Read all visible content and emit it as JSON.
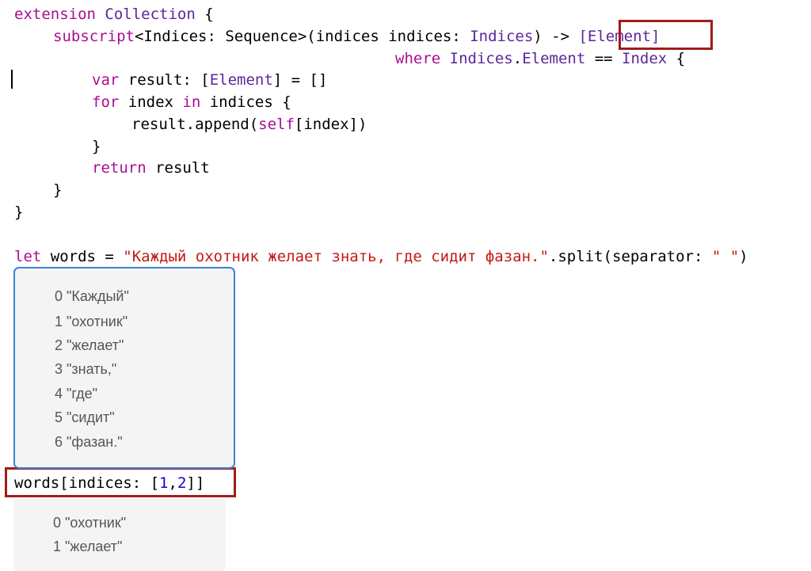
{
  "code": {
    "ext_kw": "extension",
    "ext_type": "Collection",
    "ext_open": " {",
    "sub_kw": "subscript",
    "sub_lt": "<Indices: Sequence>(indices indices: ",
    "sub_param_type": "Indices",
    "sub_arrow": ") -> ",
    "sub_ret": "[Element]",
    "where_kw": "where",
    "where_type1": "Indices",
    "where_dot": ".",
    "where_type2": "Element",
    "where_eq": " == ",
    "where_type3": "Index",
    "where_open": " {",
    "var_kw": "var",
    "var_mid": " result: [",
    "var_type": "Element",
    "var_end": "] = []",
    "for_kw": "for",
    "for_mid": " index ",
    "for_in": "in",
    "for_end": " indices {",
    "append_start": "result.append(",
    "append_self": "self",
    "append_end": "[index])",
    "close_inner": "}",
    "return_kw": "return",
    "return_end": " result",
    "close_sub": "}",
    "close_ext": "}",
    "let_kw": "let",
    "let_mid": " words = ",
    "let_str": "\"Каждый охотник желает знать, где сидит фазан.\"",
    "let_split": ".split(separator: ",
    "let_sep": "\" \"",
    "let_close": ")",
    "call_start": "words[indices: [",
    "call_n1": "1",
    "call_comma": ",",
    "call_n2": "2",
    "call_end": "]]"
  },
  "words_result": {
    "items": [
      {
        "index": "0",
        "value": "\"Каждый\""
      },
      {
        "index": "1",
        "value": "\"охотник\""
      },
      {
        "index": "2",
        "value": "\"желает\""
      },
      {
        "index": "3",
        "value": "\"знать,\""
      },
      {
        "index": "4",
        "value": "\"где\""
      },
      {
        "index": "5",
        "value": "\"сидит\""
      },
      {
        "index": "6",
        "value": "\"фазан.\""
      }
    ]
  },
  "subscript_result": {
    "items": [
      {
        "index": "0",
        "value": "\"охотник\""
      },
      {
        "index": "1",
        "value": "\"желает\""
      }
    ]
  },
  "colors": {
    "keyword": "#aa0d91",
    "type": "#5c2699",
    "string": "#c41a16",
    "number": "#1c00cf",
    "highlight_box": "#a01c1c",
    "selection_border": "#3b82d6",
    "result_bg": "#f4f4f4"
  }
}
